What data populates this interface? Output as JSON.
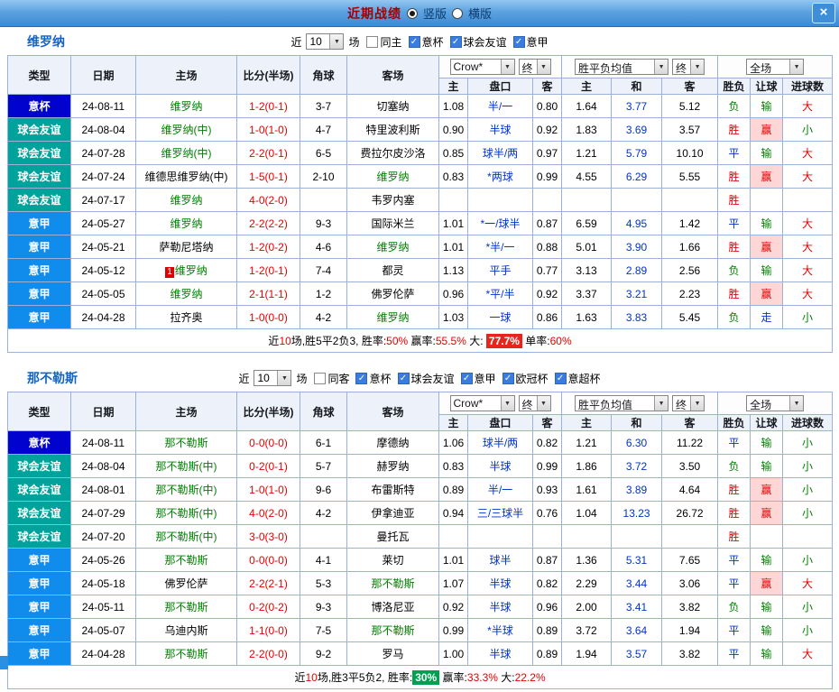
{
  "titlebar": {
    "title": "近期战绩",
    "vertical_label": "竖版",
    "horizontal_label": "横版",
    "selected_layout": "竖版",
    "close_glyph": "×"
  },
  "columns": [
    "类型",
    "日期",
    "主场",
    "比分(半场)",
    "角球",
    "客场",
    "主",
    "盘口",
    "客",
    "主",
    "和",
    "客",
    "胜负",
    "让球",
    "进球数"
  ],
  "selects": {
    "bookmaker": "Crow*",
    "final": "终",
    "avg": "胜平负均值",
    "scope": "全场"
  },
  "colors": {
    "type_badge": {
      "意杯": "#0202CF",
      "球会友谊": "#00A39B",
      "意甲": "#0F8CEC"
    },
    "result": {
      "胜": "#E60000",
      "平": "#0033CC",
      "负": "#008000"
    },
    "handicap_result": {
      "赢": "#E60000",
      "输": "#008000",
      "走": "#0033CC"
    },
    "handicap_result_bg": {
      "赢": "#FFD6D6"
    },
    "goals": {
      "大": "#E60000",
      "小": "#008000"
    },
    "focus_team": "#008000",
    "score": "#E60000",
    "handicap_text": "#0033CC",
    "draw_odds": "#0033CC",
    "summary_red": "#E60000",
    "badge_red": "#E8251D",
    "badge_green": "#00A050",
    "checkbox_on": "#3B7DDE"
  },
  "sections": [
    {
      "title": "维罗纳",
      "filter": {
        "near_label": "近",
        "count": "10",
        "games_label": "场",
        "checks": [
          {
            "label": "同主",
            "on": false
          },
          {
            "label": "意杯",
            "on": true
          },
          {
            "label": "球会友谊",
            "on": true
          },
          {
            "label": "意甲",
            "on": true
          }
        ]
      },
      "rows": [
        {
          "type": "意杯",
          "date": "24-08-11",
          "home": "维罗纳",
          "hf": true,
          "score": "1-2(0-1)",
          "corner": "3-7",
          "away": "切塞纳",
          "af": false,
          "oh": "1.08",
          "hc": "半/一",
          "oa": "0.80",
          "eh": "1.64",
          "ed": "3.77",
          "ea": "5.12",
          "res": "负",
          "lr": "输",
          "gl": "大"
        },
        {
          "type": "球会友谊",
          "date": "24-08-04",
          "home": "维罗纳(中)",
          "hf": true,
          "score": "1-0(1-0)",
          "corner": "4-7",
          "away": "特里波利斯",
          "af": false,
          "oh": "0.90",
          "hc": "半球",
          "oa": "0.92",
          "eh": "1.83",
          "ed": "3.69",
          "ea": "3.57",
          "res": "胜",
          "lr": "赢",
          "gl": "小"
        },
        {
          "type": "球会友谊",
          "date": "24-07-28",
          "home": "维罗纳(中)",
          "hf": true,
          "score": "2-2(0-1)",
          "corner": "6-5",
          "away": "费拉尔皮沙洛",
          "af": false,
          "oh": "0.85",
          "hc": "球半/两",
          "oa": "0.97",
          "eh": "1.21",
          "ed": "5.79",
          "ea": "10.10",
          "res": "平",
          "lr": "输",
          "gl": "大"
        },
        {
          "type": "球会友谊",
          "date": "24-07-24",
          "home": "维德思维罗纳(中)",
          "hf": false,
          "score": "1-5(0-1)",
          "corner": "2-10",
          "away": "维罗纳",
          "af": true,
          "oh": "0.83",
          "hc": "*两球",
          "oa": "0.99",
          "eh": "4.55",
          "ed": "6.29",
          "ea": "5.55",
          "res": "胜",
          "lr": "赢",
          "gl": "大"
        },
        {
          "type": "球会友谊",
          "date": "24-07-17",
          "home": "维罗纳",
          "hf": true,
          "score": "4-0(2-0)",
          "corner": "",
          "away": "韦罗内塞",
          "af": false,
          "oh": "",
          "hc": "",
          "oa": "",
          "eh": "",
          "ed": "",
          "ea": "",
          "res": "胜",
          "lr": "",
          "gl": ""
        },
        {
          "type": "意甲",
          "date": "24-05-27",
          "home": "维罗纳",
          "hf": true,
          "score": "2-2(2-2)",
          "corner": "9-3",
          "away": "国际米兰",
          "af": false,
          "oh": "1.01",
          "hc": "*一/球半",
          "oa": "0.87",
          "eh": "6.59",
          "ed": "4.95",
          "ea": "1.42",
          "res": "平",
          "lr": "输",
          "gl": "大"
        },
        {
          "type": "意甲",
          "date": "24-05-21",
          "home": "萨勒尼塔纳",
          "hf": false,
          "score": "1-2(0-2)",
          "corner": "4-6",
          "away": "维罗纳",
          "af": true,
          "oh": "1.01",
          "hc": "*半/一",
          "oa": "0.88",
          "eh": "5.01",
          "ed": "3.90",
          "ea": "1.66",
          "res": "胜",
          "lr": "赢",
          "gl": "大"
        },
        {
          "type": "意甲",
          "date": "24-05-12",
          "home": "维罗纳",
          "hf": true,
          "hbadge": "1",
          "score": "1-2(0-1)",
          "corner": "7-4",
          "away": "都灵",
          "af": false,
          "oh": "1.13",
          "hc": "平手",
          "oa": "0.77",
          "eh": "3.13",
          "ed": "2.89",
          "ea": "2.56",
          "res": "负",
          "lr": "输",
          "gl": "大"
        },
        {
          "type": "意甲",
          "date": "24-05-05",
          "home": "维罗纳",
          "hf": true,
          "score": "2-1(1-1)",
          "corner": "1-2",
          "away": "佛罗伦萨",
          "af": false,
          "oh": "0.96",
          "hc": "*平/半",
          "oa": "0.92",
          "eh": "3.37",
          "ed": "3.21",
          "ea": "2.23",
          "res": "胜",
          "lr": "赢",
          "gl": "大"
        },
        {
          "type": "意甲",
          "date": "24-04-28",
          "home": "拉齐奥",
          "hf": false,
          "score": "1-0(0-0)",
          "corner": "4-2",
          "away": "维罗纳",
          "af": true,
          "oh": "1.03",
          "hc": "一球",
          "oa": "0.86",
          "eh": "1.63",
          "ed": "3.83",
          "ea": "5.45",
          "res": "负",
          "lr": "走",
          "gl": "小"
        }
      ],
      "summary": [
        {
          "t": "近"
        },
        {
          "t": "10",
          "c": "red"
        },
        {
          "t": "场,胜5平2负3, 胜率:"
        },
        {
          "t": "50%",
          "c": "red"
        },
        {
          "t": " 赢率:"
        },
        {
          "t": "55.5%",
          "c": "red"
        },
        {
          "t": " 大: "
        },
        {
          "t": "77.7%",
          "c": "badge-red"
        },
        {
          "t": " 单率:"
        },
        {
          "t": "60%",
          "c": "red"
        }
      ]
    },
    {
      "title": "那不勒斯",
      "filter": {
        "near_label": "近",
        "count": "10",
        "games_label": "场",
        "checks": [
          {
            "label": "同客",
            "on": false
          },
          {
            "label": "意杯",
            "on": true
          },
          {
            "label": "球会友谊",
            "on": true
          },
          {
            "label": "意甲",
            "on": true
          },
          {
            "label": "欧冠杯",
            "on": true
          },
          {
            "label": "意超杯",
            "on": true
          }
        ]
      },
      "rows": [
        {
          "type": "意杯",
          "date": "24-08-11",
          "home": "那不勒斯",
          "hf": true,
          "score": "0-0(0-0)",
          "corner": "6-1",
          "away": "摩德纳",
          "af": false,
          "oh": "1.06",
          "hc": "球半/两",
          "oa": "0.82",
          "eh": "1.21",
          "ed": "6.30",
          "ea": "11.22",
          "res": "平",
          "lr": "输",
          "gl": "小"
        },
        {
          "type": "球会友谊",
          "date": "24-08-04",
          "home": "那不勒斯(中)",
          "hf": true,
          "score": "0-2(0-1)",
          "corner": "5-7",
          "away": "赫罗纳",
          "af": false,
          "oh": "0.83",
          "hc": "半球",
          "oa": "0.99",
          "eh": "1.86",
          "ed": "3.72",
          "ea": "3.50",
          "res": "负",
          "lr": "输",
          "gl": "小"
        },
        {
          "type": "球会友谊",
          "date": "24-08-01",
          "home": "那不勒斯(中)",
          "hf": true,
          "score": "1-0(1-0)",
          "corner": "9-6",
          "away": "布雷斯特",
          "af": false,
          "oh": "0.89",
          "hc": "半/一",
          "oa": "0.93",
          "eh": "1.61",
          "ed": "3.89",
          "ea": "4.64",
          "res": "胜",
          "lr": "赢",
          "gl": "小"
        },
        {
          "type": "球会友谊",
          "date": "24-07-29",
          "home": "那不勒斯(中)",
          "hf": true,
          "score": "4-0(2-0)",
          "corner": "4-2",
          "away": "伊拿迪亚",
          "af": false,
          "oh": "0.94",
          "hc": "三/三球半",
          "oa": "0.76",
          "eh": "1.04",
          "ed": "13.23",
          "ea": "26.72",
          "res": "胜",
          "lr": "赢",
          "gl": "小"
        },
        {
          "type": "球会友谊",
          "date": "24-07-20",
          "home": "那不勒斯(中)",
          "hf": true,
          "score": "3-0(3-0)",
          "corner": "",
          "away": "曼托瓦",
          "af": false,
          "oh": "",
          "hc": "",
          "oa": "",
          "eh": "",
          "ed": "",
          "ea": "",
          "res": "胜",
          "lr": "",
          "gl": ""
        },
        {
          "type": "意甲",
          "date": "24-05-26",
          "home": "那不勒斯",
          "hf": true,
          "score": "0-0(0-0)",
          "corner": "4-1",
          "away": "莱切",
          "af": false,
          "oh": "1.01",
          "hc": "球半",
          "oa": "0.87",
          "eh": "1.36",
          "ed": "5.31",
          "ea": "7.65",
          "res": "平",
          "lr": "输",
          "gl": "小"
        },
        {
          "type": "意甲",
          "date": "24-05-18",
          "home": "佛罗伦萨",
          "hf": false,
          "score": "2-2(2-1)",
          "corner": "5-3",
          "away": "那不勒斯",
          "af": true,
          "oh": "1.07",
          "hc": "半球",
          "oa": "0.82",
          "eh": "2.29",
          "ed": "3.44",
          "ea": "3.06",
          "res": "平",
          "lr": "赢",
          "gl": "大"
        },
        {
          "type": "意甲",
          "date": "24-05-11",
          "home": "那不勒斯",
          "hf": true,
          "score": "0-2(0-2)",
          "corner": "9-3",
          "away": "博洛尼亚",
          "af": false,
          "oh": "0.92",
          "hc": "半球",
          "oa": "0.96",
          "eh": "2.00",
          "ed": "3.41",
          "ea": "3.82",
          "res": "负",
          "lr": "输",
          "gl": "小"
        },
        {
          "type": "意甲",
          "date": "24-05-07",
          "home": "乌迪内斯",
          "hf": false,
          "score": "1-1(0-0)",
          "corner": "7-5",
          "away": "那不勒斯",
          "af": true,
          "oh": "0.99",
          "hc": "*半球",
          "oa": "0.89",
          "eh": "3.72",
          "ed": "3.64",
          "ea": "1.94",
          "res": "平",
          "lr": "输",
          "gl": "小"
        },
        {
          "type": "意甲",
          "date": "24-04-28",
          "home": "那不勒斯",
          "hf": true,
          "score": "2-2(0-0)",
          "corner": "9-2",
          "away": "罗马",
          "af": false,
          "oh": "1.00",
          "hc": "半球",
          "oa": "0.89",
          "eh": "1.94",
          "ed": "3.57",
          "ea": "3.82",
          "res": "平",
          "lr": "输",
          "gl": "大"
        }
      ],
      "summary": [
        {
          "t": "近"
        },
        {
          "t": "10",
          "c": "red"
        },
        {
          "t": "场,胜3平5负2, 胜率:"
        },
        {
          "t": "30%",
          "c": "badge-green"
        },
        {
          "t": " 赢率:"
        },
        {
          "t": "33.3%",
          "c": "red"
        },
        {
          "t": " 大:"
        },
        {
          "t": "22.2%",
          "c": "red"
        }
      ]
    }
  ]
}
